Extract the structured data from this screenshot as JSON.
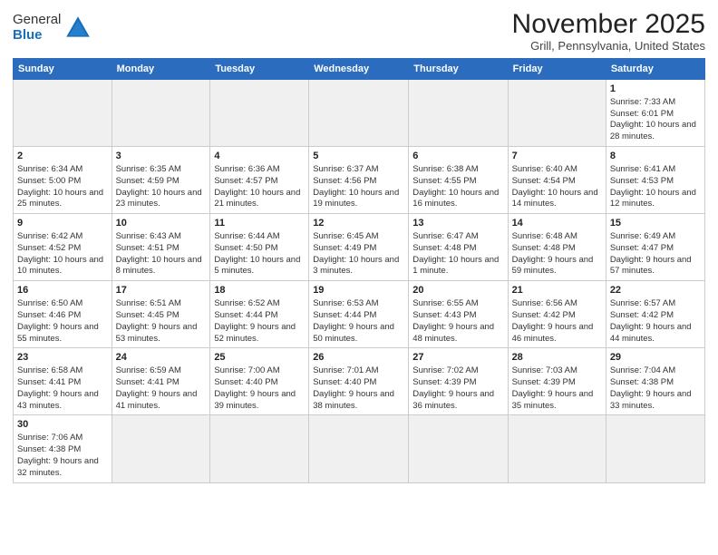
{
  "logo": {
    "line1": "General",
    "line2": "Blue"
  },
  "title": "November 2025",
  "subtitle": "Grill, Pennsylvania, United States",
  "weekdays": [
    "Sunday",
    "Monday",
    "Tuesday",
    "Wednesday",
    "Thursday",
    "Friday",
    "Saturday"
  ],
  "weeks": [
    [
      {
        "day": "",
        "info": ""
      },
      {
        "day": "",
        "info": ""
      },
      {
        "day": "",
        "info": ""
      },
      {
        "day": "",
        "info": ""
      },
      {
        "day": "",
        "info": ""
      },
      {
        "day": "",
        "info": ""
      },
      {
        "day": "1",
        "info": "Sunrise: 7:33 AM\nSunset: 6:01 PM\nDaylight: 10 hours and 28 minutes."
      }
    ],
    [
      {
        "day": "2",
        "info": "Sunrise: 6:34 AM\nSunset: 5:00 PM\nDaylight: 10 hours and 25 minutes."
      },
      {
        "day": "3",
        "info": "Sunrise: 6:35 AM\nSunset: 4:59 PM\nDaylight: 10 hours and 23 minutes."
      },
      {
        "day": "4",
        "info": "Sunrise: 6:36 AM\nSunset: 4:57 PM\nDaylight: 10 hours and 21 minutes."
      },
      {
        "day": "5",
        "info": "Sunrise: 6:37 AM\nSunset: 4:56 PM\nDaylight: 10 hours and 19 minutes."
      },
      {
        "day": "6",
        "info": "Sunrise: 6:38 AM\nSunset: 4:55 PM\nDaylight: 10 hours and 16 minutes."
      },
      {
        "day": "7",
        "info": "Sunrise: 6:40 AM\nSunset: 4:54 PM\nDaylight: 10 hours and 14 minutes."
      },
      {
        "day": "8",
        "info": "Sunrise: 6:41 AM\nSunset: 4:53 PM\nDaylight: 10 hours and 12 minutes."
      }
    ],
    [
      {
        "day": "9",
        "info": "Sunrise: 6:42 AM\nSunset: 4:52 PM\nDaylight: 10 hours and 10 minutes."
      },
      {
        "day": "10",
        "info": "Sunrise: 6:43 AM\nSunset: 4:51 PM\nDaylight: 10 hours and 8 minutes."
      },
      {
        "day": "11",
        "info": "Sunrise: 6:44 AM\nSunset: 4:50 PM\nDaylight: 10 hours and 5 minutes."
      },
      {
        "day": "12",
        "info": "Sunrise: 6:45 AM\nSunset: 4:49 PM\nDaylight: 10 hours and 3 minutes."
      },
      {
        "day": "13",
        "info": "Sunrise: 6:47 AM\nSunset: 4:48 PM\nDaylight: 10 hours and 1 minute."
      },
      {
        "day": "14",
        "info": "Sunrise: 6:48 AM\nSunset: 4:48 PM\nDaylight: 9 hours and 59 minutes."
      },
      {
        "day": "15",
        "info": "Sunrise: 6:49 AM\nSunset: 4:47 PM\nDaylight: 9 hours and 57 minutes."
      }
    ],
    [
      {
        "day": "16",
        "info": "Sunrise: 6:50 AM\nSunset: 4:46 PM\nDaylight: 9 hours and 55 minutes."
      },
      {
        "day": "17",
        "info": "Sunrise: 6:51 AM\nSunset: 4:45 PM\nDaylight: 9 hours and 53 minutes."
      },
      {
        "day": "18",
        "info": "Sunrise: 6:52 AM\nSunset: 4:44 PM\nDaylight: 9 hours and 52 minutes."
      },
      {
        "day": "19",
        "info": "Sunrise: 6:53 AM\nSunset: 4:44 PM\nDaylight: 9 hours and 50 minutes."
      },
      {
        "day": "20",
        "info": "Sunrise: 6:55 AM\nSunset: 4:43 PM\nDaylight: 9 hours and 48 minutes."
      },
      {
        "day": "21",
        "info": "Sunrise: 6:56 AM\nSunset: 4:42 PM\nDaylight: 9 hours and 46 minutes."
      },
      {
        "day": "22",
        "info": "Sunrise: 6:57 AM\nSunset: 4:42 PM\nDaylight: 9 hours and 44 minutes."
      }
    ],
    [
      {
        "day": "23",
        "info": "Sunrise: 6:58 AM\nSunset: 4:41 PM\nDaylight: 9 hours and 43 minutes."
      },
      {
        "day": "24",
        "info": "Sunrise: 6:59 AM\nSunset: 4:41 PM\nDaylight: 9 hours and 41 minutes."
      },
      {
        "day": "25",
        "info": "Sunrise: 7:00 AM\nSunset: 4:40 PM\nDaylight: 9 hours and 39 minutes."
      },
      {
        "day": "26",
        "info": "Sunrise: 7:01 AM\nSunset: 4:40 PM\nDaylight: 9 hours and 38 minutes."
      },
      {
        "day": "27",
        "info": "Sunrise: 7:02 AM\nSunset: 4:39 PM\nDaylight: 9 hours and 36 minutes."
      },
      {
        "day": "28",
        "info": "Sunrise: 7:03 AM\nSunset: 4:39 PM\nDaylight: 9 hours and 35 minutes."
      },
      {
        "day": "29",
        "info": "Sunrise: 7:04 AM\nSunset: 4:38 PM\nDaylight: 9 hours and 33 minutes."
      }
    ],
    [
      {
        "day": "30",
        "info": "Sunrise: 7:06 AM\nSunset: 4:38 PM\nDaylight: 9 hours and 32 minutes."
      },
      {
        "day": "",
        "info": ""
      },
      {
        "day": "",
        "info": ""
      },
      {
        "day": "",
        "info": ""
      },
      {
        "day": "",
        "info": ""
      },
      {
        "day": "",
        "info": ""
      },
      {
        "day": "",
        "info": ""
      }
    ]
  ]
}
